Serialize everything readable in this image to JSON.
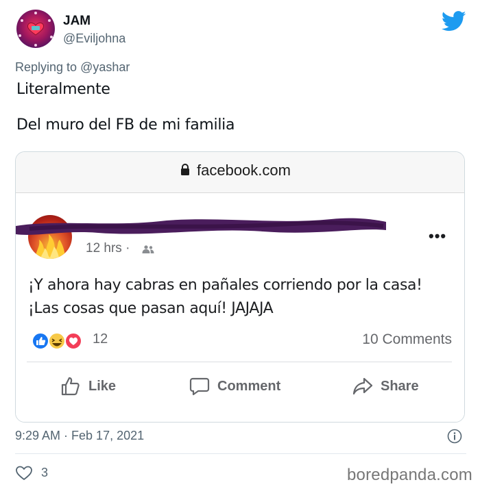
{
  "author": {
    "display_name": "JAM",
    "handle": "@Eviljohna",
    "avatar_icon": "heart-avatar-icon"
  },
  "reply": {
    "prefix": "Replying to",
    "mention": "@yashar"
  },
  "tweet": {
    "lines": [
      "Literalmente",
      "Del muro del FB de mi familia"
    ]
  },
  "browser": {
    "url": "facebook.com",
    "lock_icon": "lock-icon"
  },
  "facebook_post": {
    "time": "12 hrs ·",
    "audience_icon": "friends-icon",
    "more_label": "•••",
    "text_lines": [
      "¡Y ahora hay cabras en pañales corriendo por la casa!",
      "¡Las cosas que pasan aquí! JAJAJA"
    ],
    "reaction_count": "12",
    "comments_count": "10 Comments",
    "actions": {
      "like": "Like",
      "comment": "Comment",
      "share": "Share"
    },
    "colors": {
      "like_blue": "#1877f2",
      "haha_yellow": "#f7c948",
      "love_red": "#f33e58",
      "scribble": "#4a1d5c"
    }
  },
  "meta": {
    "timestamp": "9:29 AM · Feb 17, 2021",
    "likes": "3"
  },
  "watermark": "boredpanda.com",
  "colors": {
    "twitter_blue": "#1d9bf0",
    "secondary_text": "#536471"
  }
}
